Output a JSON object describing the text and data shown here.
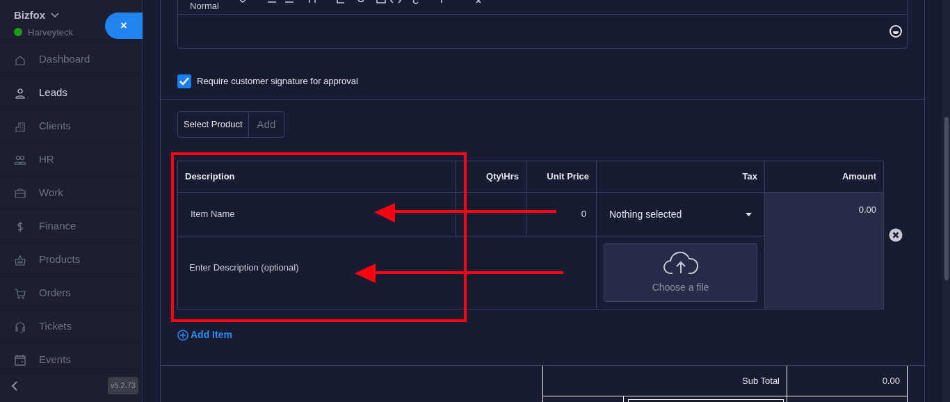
{
  "sidebar": {
    "brand": "Bizfox",
    "workspace": "Harveyteck",
    "online": true,
    "close_label": "×",
    "items": [
      {
        "label": "Dashboard",
        "selected": false
      },
      {
        "label": "Leads",
        "selected": true
      },
      {
        "label": "Clients",
        "selected": false
      },
      {
        "label": "HR",
        "selected": false
      },
      {
        "label": "Work",
        "selected": false
      },
      {
        "label": "Finance",
        "selected": false
      },
      {
        "label": "Products",
        "selected": false
      },
      {
        "label": "Orders",
        "selected": false
      },
      {
        "label": "Tickets",
        "selected": false
      },
      {
        "label": "Events",
        "selected": false
      }
    ],
    "version": "v5.2.73"
  },
  "editor": {
    "format": "Normal"
  },
  "signature": {
    "label": "Require customer signature for approval",
    "checked": true
  },
  "product_picker": {
    "label": "Select Product",
    "button": "Add"
  },
  "items_table": {
    "columns": [
      "Description",
      "Qty\\Hrs",
      "Unit Price",
      "Tax",
      "Amount"
    ],
    "rows": [
      {
        "item_name_placeholder": "Item Name",
        "unit_price": "0",
        "tax": "Nothing selected",
        "description_placeholder": "Enter Description (optional)",
        "upload_label": "Choose a file",
        "amount": "0.00"
      }
    ]
  },
  "add_item": "Add Item",
  "totals": [
    {
      "label": "Sub Total",
      "value": "0.00"
    }
  ]
}
